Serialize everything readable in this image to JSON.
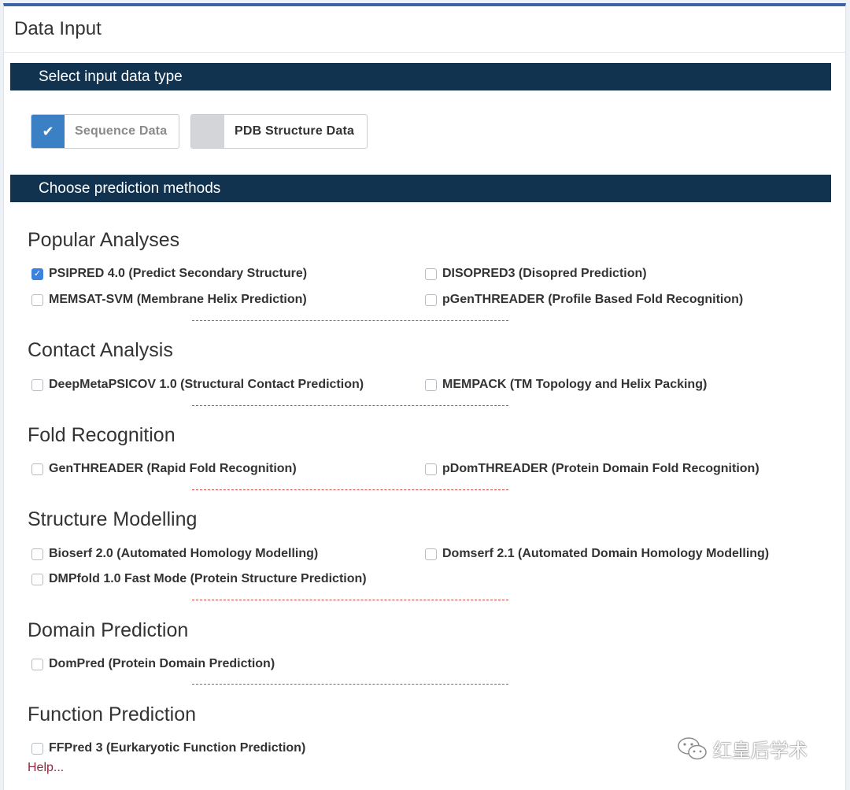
{
  "panel": {
    "title": "Data Input"
  },
  "input_type": {
    "bar_label": "Select input data type",
    "options": [
      {
        "label": "Sequence Data",
        "selected": true
      },
      {
        "label": "PDB Structure Data",
        "selected": false
      }
    ]
  },
  "methods": {
    "bar_label": "Choose prediction methods",
    "groups": [
      {
        "title": "Popular Analyses",
        "options": [
          {
            "label": "PSIPRED 4.0 (Predict Secondary Structure)",
            "checked": true
          },
          {
            "label": "DISOPRED3 (Disopred Prediction)",
            "checked": false
          },
          {
            "label": "MEMSAT-SVM (Membrane Helix Prediction)",
            "checked": false
          },
          {
            "label": "pGenTHREADER (Profile Based Fold Recognition)",
            "checked": false
          }
        ]
      },
      {
        "title": "Contact Analysis",
        "options": [
          {
            "label": "DeepMetaPSICOV 1.0 (Structural Contact Prediction)",
            "checked": false
          },
          {
            "label": "MEMPACK (TM Topology and Helix Packing)",
            "checked": false
          }
        ]
      },
      {
        "title": "Fold Recognition",
        "options": [
          {
            "label": "GenTHREADER (Rapid Fold Recognition)",
            "checked": false
          },
          {
            "label": "pDomTHREADER (Protein Domain Fold Recognition)",
            "checked": false
          }
        ]
      },
      {
        "title": "Structure Modelling",
        "options": [
          {
            "label": "Bioserf 2.0 (Automated Homology Modelling)",
            "checked": false
          },
          {
            "label": "Domserf 2.1 (Automated Domain Homology Modelling)",
            "checked": false
          },
          {
            "label": "DMPfold 1.0 Fast Mode (Protein Structure Prediction)",
            "checked": false
          }
        ]
      },
      {
        "title": "Domain Prediction",
        "options": [
          {
            "label": "DomPred (Protein Domain Prediction)",
            "checked": false
          }
        ]
      },
      {
        "title": "Function Prediction",
        "options": [
          {
            "label": "FFPred 3 (Eurkaryotic Function Prediction)",
            "checked": false
          }
        ]
      }
    ],
    "help_link": "Help..."
  },
  "watermark": {
    "text": "红皇后学术",
    "icon": "wechat-icon"
  },
  "colors": {
    "bar": "#12334f",
    "accent": "#3b82e0",
    "top_border": "#3d62a8",
    "dash": "#d04848",
    "help": "#8b2a3e"
  }
}
